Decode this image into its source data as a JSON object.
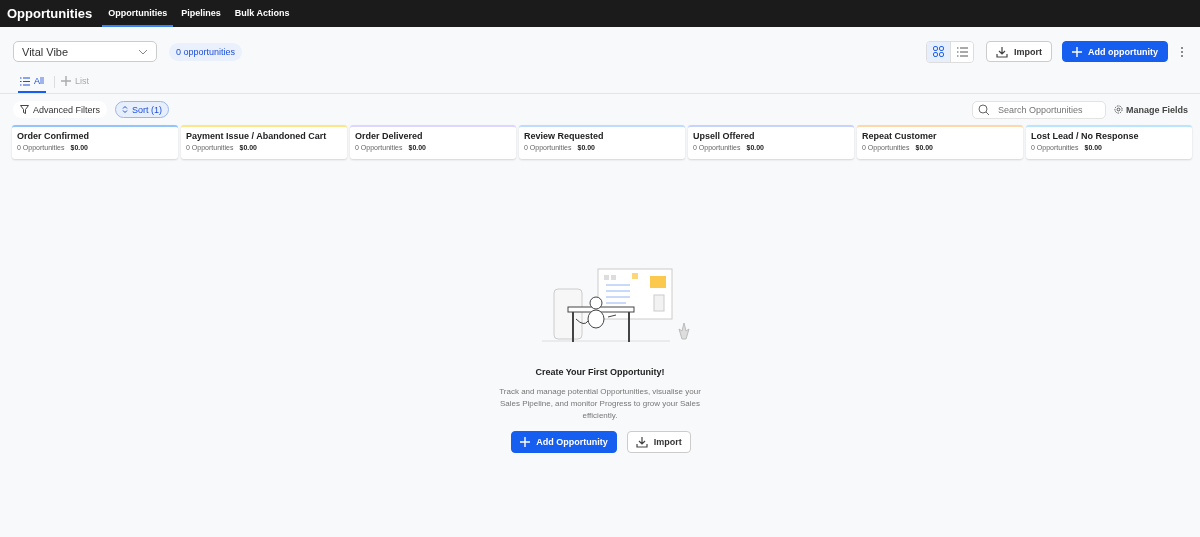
{
  "header": {
    "title": "Opportunities",
    "nav": [
      {
        "label": "Opportunities",
        "selected": true
      },
      {
        "label": "Pipelines",
        "selected": false
      },
      {
        "label": "Bulk Actions",
        "selected": false
      }
    ]
  },
  "toolbar": {
    "pipeline_select": {
      "value": "Vital Vibe"
    },
    "count_badge": "0 opportunities",
    "views": [
      {
        "kind": "grid",
        "selected": true
      },
      {
        "kind": "list",
        "selected": false
      }
    ],
    "import_button": "Import",
    "add_button": "Add opportunity"
  },
  "view_tabs": [
    {
      "kind": "tab",
      "label": "All",
      "selected": true
    },
    {
      "kind": "add",
      "label": "List",
      "selected": false
    }
  ],
  "filters": {
    "advanced_filters": "Advanced Filters",
    "sort": "Sort (1)",
    "search": {
      "placeholder": "Search Opportunities"
    },
    "manage_fields": "Manage Fields"
  },
  "stages": [
    {
      "name": "Order Confirmed",
      "count": "0 Opportunities",
      "amount": "$0.00",
      "color": "#93c5fd"
    },
    {
      "name": "Payment Issue / Abandoned Cart",
      "count": "0 Opportunities",
      "amount": "$0.00",
      "color": "#fde68a"
    },
    {
      "name": "Order Delivered",
      "count": "0 Opportunities",
      "amount": "$0.00",
      "color": "#ddd6fe"
    },
    {
      "name": "Review Requested",
      "count": "0 Opportunities",
      "amount": "$0.00",
      "color": "#bfdbfe"
    },
    {
      "name": "Upsell Offered",
      "count": "0 Opportunities",
      "amount": "$0.00",
      "color": "#c7d2fe"
    },
    {
      "name": "Repeat Customer",
      "count": "0 Opportunities",
      "amount": "$0.00",
      "color": "#fed7aa"
    },
    {
      "name": "Lost Lead / No Response",
      "count": "0 Opportunities",
      "amount": "$0.00",
      "color": "#bae6fd"
    }
  ],
  "empty_state": {
    "title": "Create Your First Opportunity!",
    "description": "Track and manage potential Opportunities, visualise your Sales Pipeline, and monitor Progress to grow your Sales efficiently.",
    "add_button": "Add Opportunity",
    "import_button": "Import"
  }
}
